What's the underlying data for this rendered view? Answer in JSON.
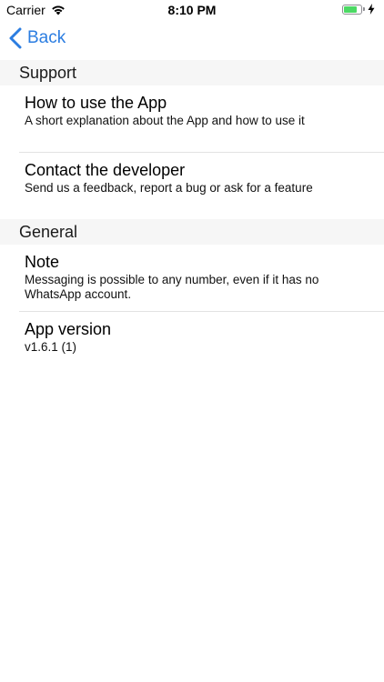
{
  "status_bar": {
    "carrier": "Carrier",
    "time": "8:10 PM",
    "battery_level": 0.8,
    "wifi_icon": "wifi-icon",
    "charging_icon": "bolt-icon"
  },
  "nav": {
    "back_label": "Back",
    "accent_color": "#2b7de1"
  },
  "sections": [
    {
      "header": "Support",
      "rows": [
        {
          "title": "How to use the App",
          "subtitle": "A short explanation about the App and how to use it"
        },
        {
          "title": "Contact the developer",
          "subtitle": "Send us a feedback, report a bug or ask for a feature"
        }
      ]
    },
    {
      "header": "General",
      "rows": [
        {
          "title": "Note",
          "subtitle": "Messaging is possible to any number, even if it has no WhatsApp account."
        },
        {
          "title": "App version",
          "subtitle": "v1.6.1 (1)"
        }
      ]
    }
  ]
}
